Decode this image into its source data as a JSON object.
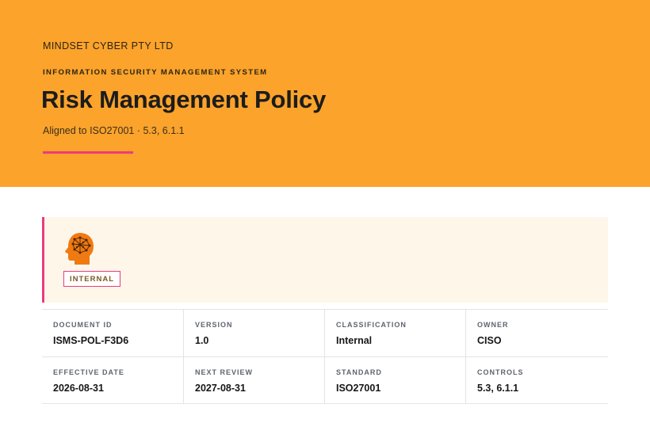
{
  "header": {
    "company": "MINDSET CYBER PTY LTD",
    "system": "INFORMATION SECURITY MANAGEMENT SYSTEM",
    "title": "Risk Management Policy",
    "subtitle": "Aligned to ISO27001 · 5.3, 6.1.1"
  },
  "card": {
    "icon": "brain-head-icon",
    "badge": "INTERNAL"
  },
  "metadata": {
    "rows": [
      [
        {
          "label": "DOCUMENT ID",
          "value": "ISMS-POL-F3D6"
        },
        {
          "label": "VERSION",
          "value": "1.0"
        },
        {
          "label": "CLASSIFICATION",
          "value": "Internal"
        },
        {
          "label": "OWNER",
          "value": "CISO"
        }
      ],
      [
        {
          "label": "EFFECTIVE DATE",
          "value": "2026-08-31"
        },
        {
          "label": "NEXT REVIEW",
          "value": "2027-08-31"
        },
        {
          "label": "STANDARD",
          "value": "ISO27001"
        },
        {
          "label": "CONTROLS",
          "value": "5.3, 6.1.1"
        }
      ]
    ]
  },
  "colors": {
    "hero": "#fba32b",
    "accent": "#ec3b7a",
    "card_bg": "#fff6ea",
    "icon": "#f07a12"
  }
}
